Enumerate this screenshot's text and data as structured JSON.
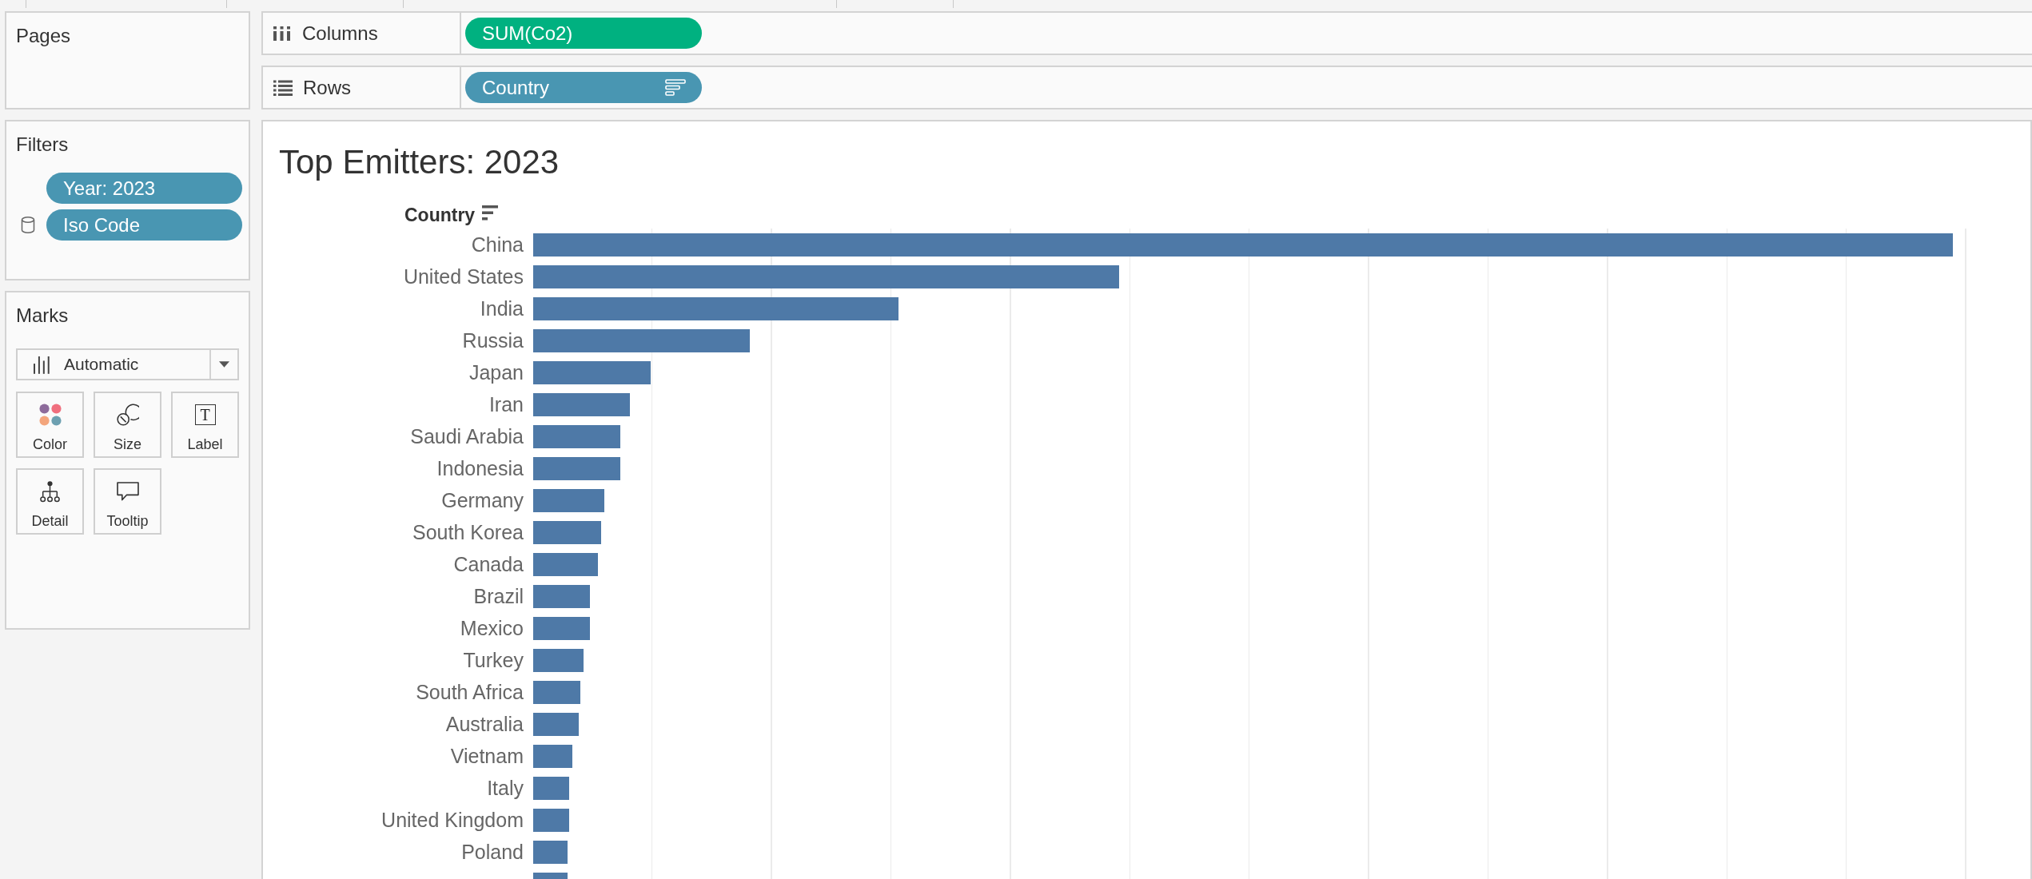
{
  "pages_card": {
    "title": "Pages"
  },
  "filters_card": {
    "title": "Filters",
    "pills": [
      {
        "label": "Year: 2023",
        "kind": "dimension",
        "source_filter": false
      },
      {
        "label": "Iso Code",
        "kind": "dimension",
        "source_filter": true
      }
    ]
  },
  "marks_card": {
    "title": "Marks",
    "mark_type": "Automatic",
    "buttons": [
      {
        "label": "Color",
        "kind": "color"
      },
      {
        "label": "Size",
        "kind": "size"
      },
      {
        "label": "Label",
        "kind": "label",
        "glyph": "T"
      },
      {
        "label": "Detail",
        "kind": "detail"
      },
      {
        "label": "Tooltip",
        "kind": "tooltip"
      }
    ]
  },
  "shelves": [
    {
      "label": "Columns",
      "kind": "columns",
      "pills": [
        {
          "label": "SUM(Co2)",
          "kind": "measure",
          "sorted": false
        }
      ]
    },
    {
      "label": "Rows",
      "kind": "rows",
      "pills": [
        {
          "label": "Country",
          "kind": "dimension",
          "sorted": true
        }
      ]
    }
  ],
  "view": {
    "title": "Top Emitters: 2023",
    "row_header": {
      "label": "Country",
      "sorted": true
    },
    "rows": [
      "China",
      "United States",
      "India",
      "Russia",
      "Japan",
      "Iran",
      "Saudi Arabia",
      "Indonesia",
      "Germany",
      "South Korea",
      "Canada",
      "Brazil",
      "Mexico",
      "Turkey",
      "South Africa",
      "Australia",
      "Vietnam",
      "Italy",
      "United Kingdom",
      "Poland"
    ]
  }
}
